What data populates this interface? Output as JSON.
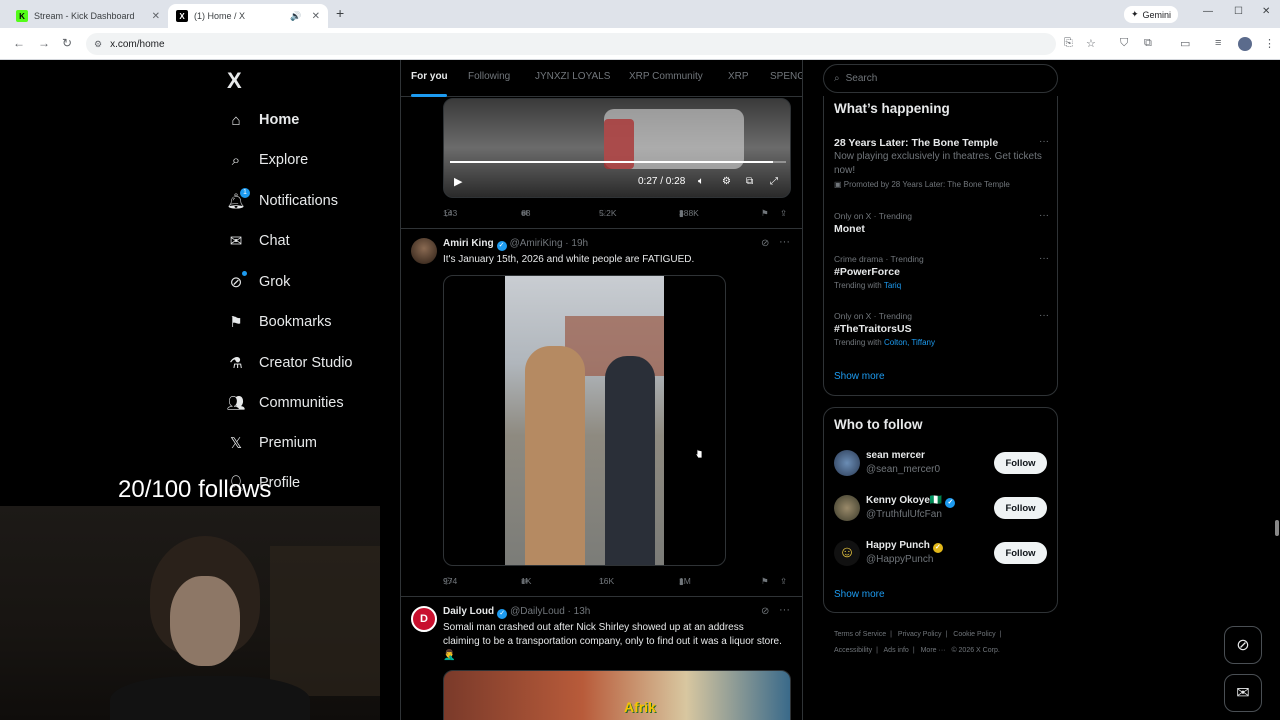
{
  "browser": {
    "tabs": [
      {
        "label": "Stream - Kick Dashboard",
        "favicon": "K",
        "active": false
      },
      {
        "label": "(1) Home / X",
        "favicon": "X",
        "active": true
      }
    ],
    "new_tab": "+",
    "gemini_label": "Gemini",
    "url": "x.com/home"
  },
  "overlay": {
    "follows_counter": "20/100 follows"
  },
  "sidebar": {
    "logo": "X",
    "notification_badge": "1",
    "items": [
      {
        "label": "Home",
        "icon": "home-icon"
      },
      {
        "label": "Explore",
        "icon": "search-icon"
      },
      {
        "label": "Notifications",
        "icon": "bell-icon"
      },
      {
        "label": "Chat",
        "icon": "mail-icon"
      },
      {
        "label": "Grok",
        "icon": "grok-icon"
      },
      {
        "label": "Bookmarks",
        "icon": "bookmark-icon"
      },
      {
        "label": "Creator Studio",
        "icon": "flask-icon"
      },
      {
        "label": "Communities",
        "icon": "people-icon"
      },
      {
        "label": "Premium",
        "icon": "x-icon"
      },
      {
        "label": "Profile",
        "icon": "person-icon"
      }
    ]
  },
  "timeline": {
    "tabs": [
      "For you",
      "Following",
      "JYNXZI LOYALS",
      "XRP Community",
      "XRP",
      "SPENG"
    ],
    "active_tab": "For you",
    "tweets": [
      {
        "video_time": "0:27 / 0:28",
        "video_progress": 0.96,
        "stats": {
          "replies": "143",
          "reposts": "63",
          "likes": "5.2K",
          "views": "388K"
        }
      },
      {
        "name": "Amiri King",
        "handle": "@AmiriKing",
        "time": "· 19h",
        "text": "It's January 15th, 2026 and white people are FATIGUED.",
        "stats": {
          "replies": "974",
          "reposts": "1K",
          "likes": "16K",
          "views": "1M"
        }
      },
      {
        "name": "Daily Loud",
        "handle": "@DailyLoud",
        "time": "· 13h",
        "text": "Somali man crashed out after Nick Shirley showed up at an address claiming to be a transportation company, only to find out it was a liquor store. 🤦‍♂️",
        "media_sign": "Afrik"
      }
    ]
  },
  "right": {
    "search_placeholder": "Search",
    "whats_happening": {
      "title": "What’s happening",
      "trends": [
        {
          "title": "28 Years Later: The Bone Temple",
          "sub": "Now playing exclusively in theatres. Get tickets now!",
          "promo": "Promoted by 28 Years Later: The Bone Temple"
        },
        {
          "meta": "Only on X · Trending",
          "title": "Monet"
        },
        {
          "meta": "Crime drama · Trending",
          "title": "#PowerForce",
          "with_label": "Trending with",
          "with": "Tariq"
        },
        {
          "meta": "Only on X · Trending",
          "title": "#TheTraitorsUS",
          "with_label": "Trending with",
          "with": "Colton, Tiffany"
        }
      ],
      "show_more": "Show more"
    },
    "who_to_follow": {
      "title": "Who to follow",
      "button_label": "Follow",
      "accounts": [
        {
          "name": "sean mercer",
          "handle": "@sean_mercer0"
        },
        {
          "name": "Kenny Okoye🇳🇬",
          "handle": "@TruthfulUfcFan"
        },
        {
          "name": "Happy Punch",
          "handle": "@HappyPunch"
        }
      ],
      "show_more": "Show more"
    },
    "footer": [
      "Terms of Service",
      "|",
      "Privacy Policy",
      "|",
      "Cookie Policy",
      "|",
      "Accessibility",
      "|",
      "Ads info",
      "|",
      "More ···",
      "© 2026 X Corp."
    ]
  },
  "colors": {
    "accent": "#1d9bf0",
    "background": "#000000",
    "border": "#2f3336",
    "muted": "#71767b"
  }
}
